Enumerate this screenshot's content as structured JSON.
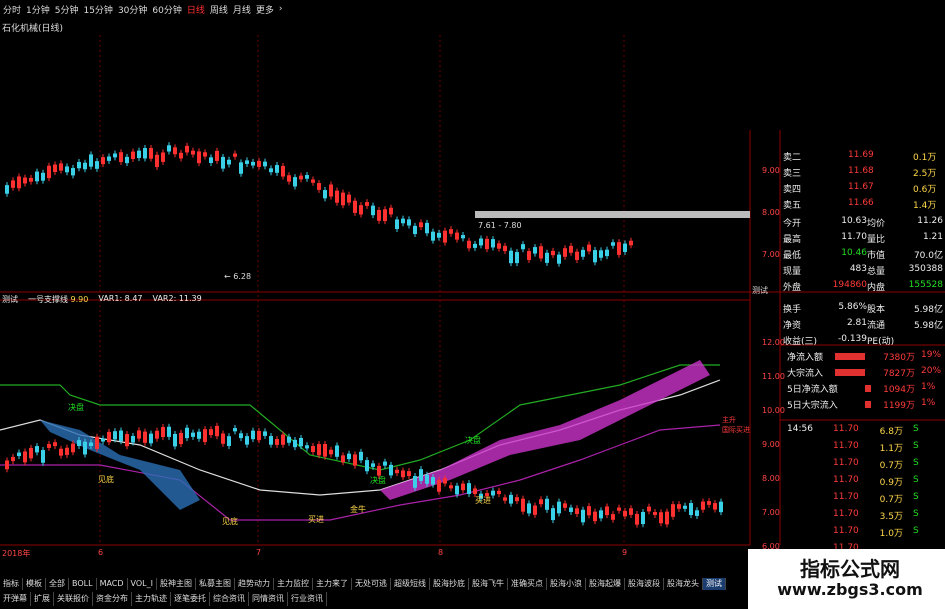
{
  "toolbar": {
    "periods": [
      "分时",
      "1分钟",
      "5分钟",
      "15分钟",
      "30分钟",
      "60分钟",
      "日线",
      "周线",
      "月线",
      "更多"
    ],
    "selected": "日线",
    "more_icon": "chevron-right-icon"
  },
  "chart_title": "石化机械(日线)",
  "price_labels": {
    "low": "6.28",
    "range": "7.61 - 7.80"
  },
  "indicator_bar": {
    "name": "测试",
    "line_name": "一号支撑线",
    "line_value": "9.90",
    "var1": "VAR1: 8.47",
    "var2": "VAR2: 11.39"
  },
  "indicator_annotations": [
    "决盘",
    "决盘",
    "决盘",
    "见底",
    "买进",
    "见底",
    "金牛",
    "买进",
    "主升",
    "国际买进"
  ],
  "indicator_axis": [
    "12.00",
    "11.00",
    "10.00",
    "9.00",
    "8.00",
    "7.00",
    "6.00"
  ],
  "price_axis": [
    "9.00",
    "8.00",
    "7.00"
  ],
  "date_axis": [
    "2018年",
    "6",
    "7",
    "8",
    "9"
  ],
  "right_label": "测试",
  "quote": {
    "asks": [
      {
        "label": "卖二",
        "price": "11.69",
        "vol": "0.1万"
      },
      {
        "label": "卖三",
        "price": "11.68",
        "vol": "2.5万"
      },
      {
        "label": "卖四",
        "price": "11.67",
        "vol": "0.6万"
      },
      {
        "label": "卖五",
        "price": "11.66",
        "vol": "1.4万"
      }
    ],
    "stats": [
      {
        "l1": "今开",
        "v1": "10.63",
        "l2": "均价",
        "v2": "11.26"
      },
      {
        "l1": "最高",
        "v1": "11.70",
        "l2": "量比",
        "v2": "1.21"
      },
      {
        "l1": "最低",
        "v1": "10.46",
        "l2": "市值",
        "v2": "70.0亿"
      },
      {
        "l1": "现量",
        "v1": "483",
        "l2": "总量",
        "v2": "350388"
      },
      {
        "l1": "外盘",
        "v1": "194860",
        "l2": "内盘",
        "v2": "155528"
      },
      {
        "l1": "换手",
        "v1": "5.86%",
        "l2": "股本",
        "v2": "5.98亿"
      },
      {
        "l1": "净资",
        "v1": "2.81",
        "l2": "流通",
        "v2": "5.98亿"
      },
      {
        "l1": "收益(三)",
        "v1": "-0.139",
        "l2": "PE(动)",
        "v2": ""
      }
    ],
    "flows": [
      {
        "label": "净流入额",
        "value": "7380万",
        "pct": "19%"
      },
      {
        "label": "大宗流入",
        "value": "7827万",
        "pct": "20%"
      },
      {
        "label": "5日净流入额",
        "value": "1094万",
        "pct": "1%"
      },
      {
        "label": "5日大宗流入",
        "value": "1199万",
        "pct": "1%"
      }
    ],
    "ticks": [
      {
        "time": "14:56",
        "price": "11.70",
        "vol": "6.8万",
        "side": "S"
      },
      {
        "time": "",
        "price": "11.70",
        "vol": "1.1万",
        "side": "S"
      },
      {
        "time": "",
        "price": "11.70",
        "vol": "0.7万",
        "side": "S"
      },
      {
        "time": "",
        "price": "11.70",
        "vol": "0.9万",
        "side": "S"
      },
      {
        "time": "",
        "price": "11.70",
        "vol": "0.7万",
        "side": "S"
      },
      {
        "time": "",
        "price": "11.70",
        "vol": "3.5万",
        "side": "S"
      },
      {
        "time": "",
        "price": "11.70",
        "vol": "1.0万",
        "side": "S"
      },
      {
        "time": "",
        "price": "11.70",
        "vol": "",
        "side": ""
      }
    ]
  },
  "tabs_row1": [
    "指标",
    "模板",
    "全部",
    "BOLL",
    "MACD",
    "VOL_I",
    "股神主图",
    "私募主图",
    "趋势动力",
    "主力监控",
    "主力来了",
    "无处可逃",
    "超级短线",
    "股海抄底",
    "股海飞牛",
    "准确买点",
    "股海小浪",
    "股海起爆",
    "股海波段",
    "股海龙头",
    "测试"
  ],
  "tabs_row1_active": "测试",
  "tabs_row2": [
    "开弹幕",
    "扩展",
    "关联报价",
    "资金分布",
    "主力轨迹",
    "逐笔委托",
    "综合资讯",
    "同情资讯",
    "行业资讯"
  ],
  "watermark": {
    "title": "指标公式网",
    "url": "www.zbgs3.com"
  }
}
